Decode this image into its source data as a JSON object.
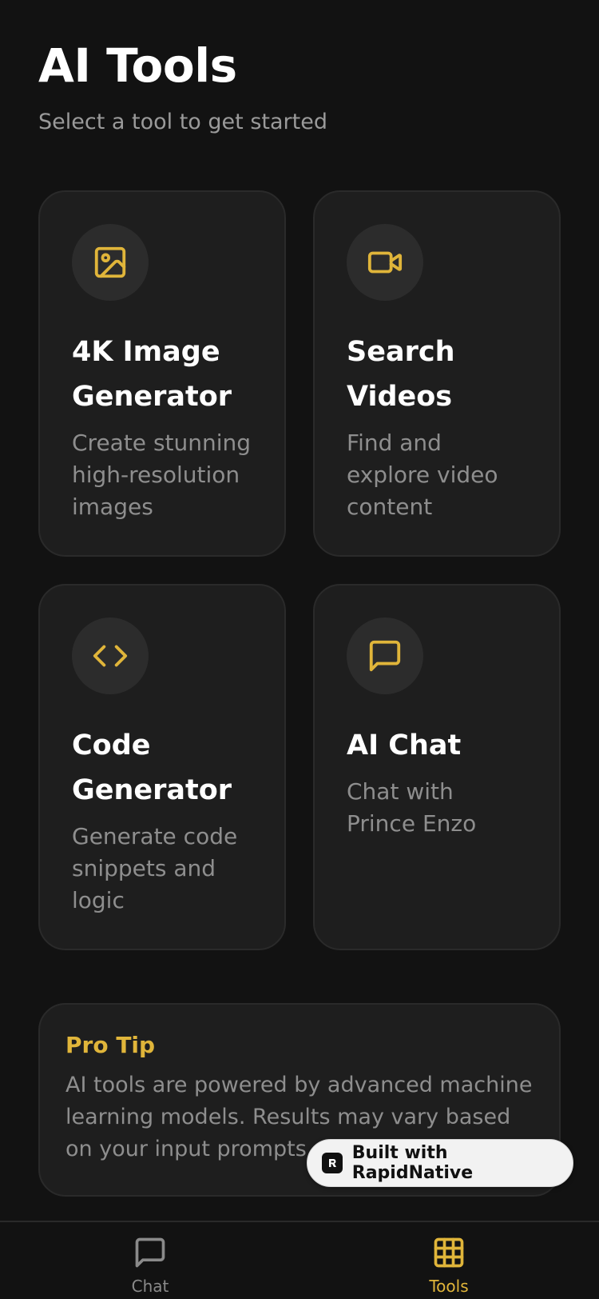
{
  "header": {
    "title": "AI Tools",
    "subtitle": "Select a tool to get started"
  },
  "tools": [
    {
      "title": "4K Image Generator",
      "description": "Create stunning high-resolution images",
      "icon": "image-icon"
    },
    {
      "title": "Search Videos",
      "description": "Find and explore video content",
      "icon": "video-icon"
    },
    {
      "title": "Code Generator",
      "description": "Generate code snippets and logic",
      "icon": "code-icon"
    },
    {
      "title": "AI Chat",
      "description": "Chat with Prince Enzo",
      "icon": "chat-bubble-icon"
    }
  ],
  "tip": {
    "title": "Pro Tip",
    "text": "AI tools are powered by advanced machine learning models. Results may vary based on your input prompts."
  },
  "badge": {
    "label": "Built with RapidNative",
    "icon": "rapidnative-logo-icon"
  },
  "tabbar": {
    "tabs": [
      {
        "label": "Chat",
        "icon": "chat-icon",
        "active": false
      },
      {
        "label": "Tools",
        "icon": "grid-icon",
        "active": true
      }
    ]
  },
  "colors": {
    "background": "#121212",
    "card": "#1e1e1e",
    "accent": "#e0b53a",
    "muted_text": "#8e8e8e",
    "inactive_tab": "#8a8a8a"
  }
}
